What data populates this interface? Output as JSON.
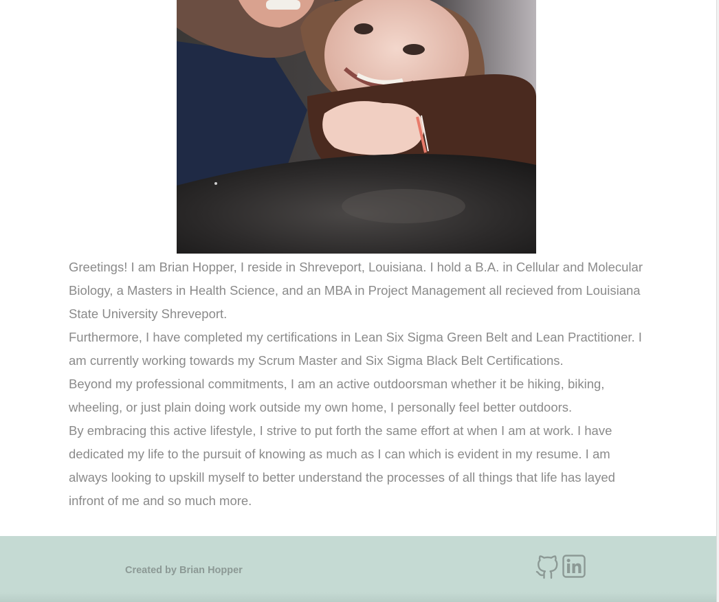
{
  "photo": {
    "alt": "Brian Hopper with his daughter"
  },
  "bio": {
    "paragraphs": [
      "Greetings! I am Brian Hopper, I reside in Shreveport, Louisiana. I hold a B.A. in Cellular and Molecular Biology, a Masters in Health Science, and an MBA in Project Management all recieved from Louisiana State University Shreveport.",
      "Furthermore, I have completed my certifications in Lean Six Sigma Green Belt and Lean Practitioner. I am currently working towards my Scrum Master and Six Sigma Black Belt Certifications.",
      "Beyond my professional commitments, I am an active outdoorsman whether it be hiking, biking, wheeling, or just plain doing work outside my own home, I personally feel better outdoors.",
      "By embracing this active lifestyle, I strive to put forth the same effort at when I am at work. I have dedicated my life to the pursuit of knowing as much as I can which is evident in my resume. I am always looking to upskill myself to better understand the processes of all things that life has layed infront of me and so much more."
    ]
  },
  "footer": {
    "credit": "Created by Brian Hopper",
    "background_color": "#c5dad3",
    "icon_color": "#8c9995",
    "links": [
      {
        "icon": "github-icon"
      },
      {
        "icon": "linkedin-icon"
      }
    ]
  }
}
